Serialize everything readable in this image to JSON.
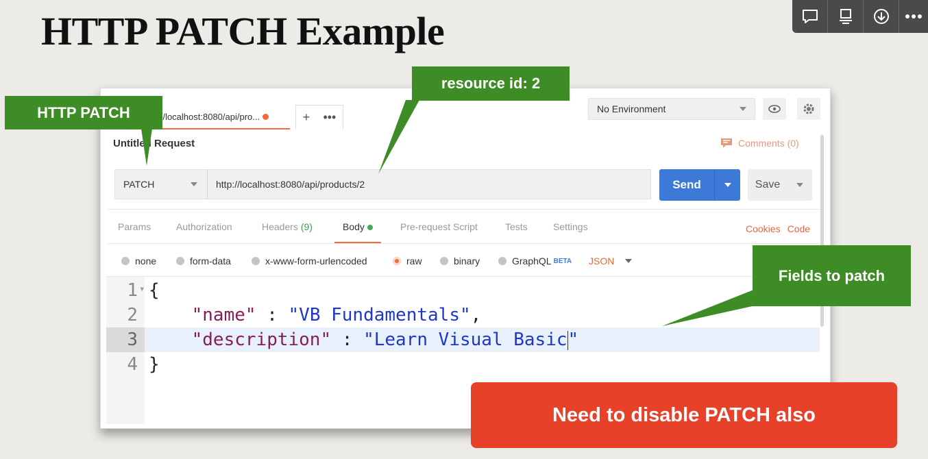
{
  "slide": {
    "title": "HTTP PATCH Example"
  },
  "viewer_toolbar": {
    "buttons": [
      "comment-icon",
      "presenter-icon",
      "download-icon",
      "more-icon"
    ]
  },
  "postman": {
    "tab": {
      "label": "p://localhost:8080/api/pro...",
      "modified": true
    },
    "environment": {
      "selected": "No Environment"
    },
    "request_title": "Untitled Request",
    "comments_label": "Comments (0)",
    "method": "PATCH",
    "url": "http://localhost:8080/api/products/2",
    "send_label": "Send",
    "save_label": "Save",
    "tabs": [
      {
        "label": "Params"
      },
      {
        "label": "Authorization"
      },
      {
        "label": "Headers",
        "count": "(9)"
      },
      {
        "label": "Body",
        "active": true
      },
      {
        "label": "Pre-request Script"
      },
      {
        "label": "Tests"
      },
      {
        "label": "Settings"
      }
    ],
    "right_links": {
      "cookies": "Cookies",
      "code": "Code"
    },
    "body_types": {
      "none": "none",
      "form_data": "form-data",
      "urlencoded": "x-www-form-urlencoded",
      "raw": "raw",
      "binary": "binary",
      "graphql": "GraphQL",
      "graphql_badge": "BETA",
      "format": "JSON",
      "selected": "raw"
    },
    "editor": {
      "line_numbers": [
        "1",
        "2",
        "3",
        "4"
      ],
      "open_brace": "{",
      "close_brace": "}",
      "name_key": "\"name\"",
      "name_value": "\"VB Fundamentals\"",
      "desc_key": "\"description\"",
      "desc_value": "\"Learn Visual Basic",
      "desc_value_end": "\"",
      "colon": " : ",
      "comma": ","
    }
  },
  "callouts": {
    "http_patch": "HTTP PATCH",
    "resource_id": "resource id: 2",
    "fields_to_patch": "Fields to patch",
    "warning": "Need to disable PATCH also"
  },
  "colors": {
    "callout_green": "#3d8c25",
    "warning_red": "#e8412a",
    "send_blue": "#3d7ad8",
    "accent_orange": "#f26b3a"
  }
}
